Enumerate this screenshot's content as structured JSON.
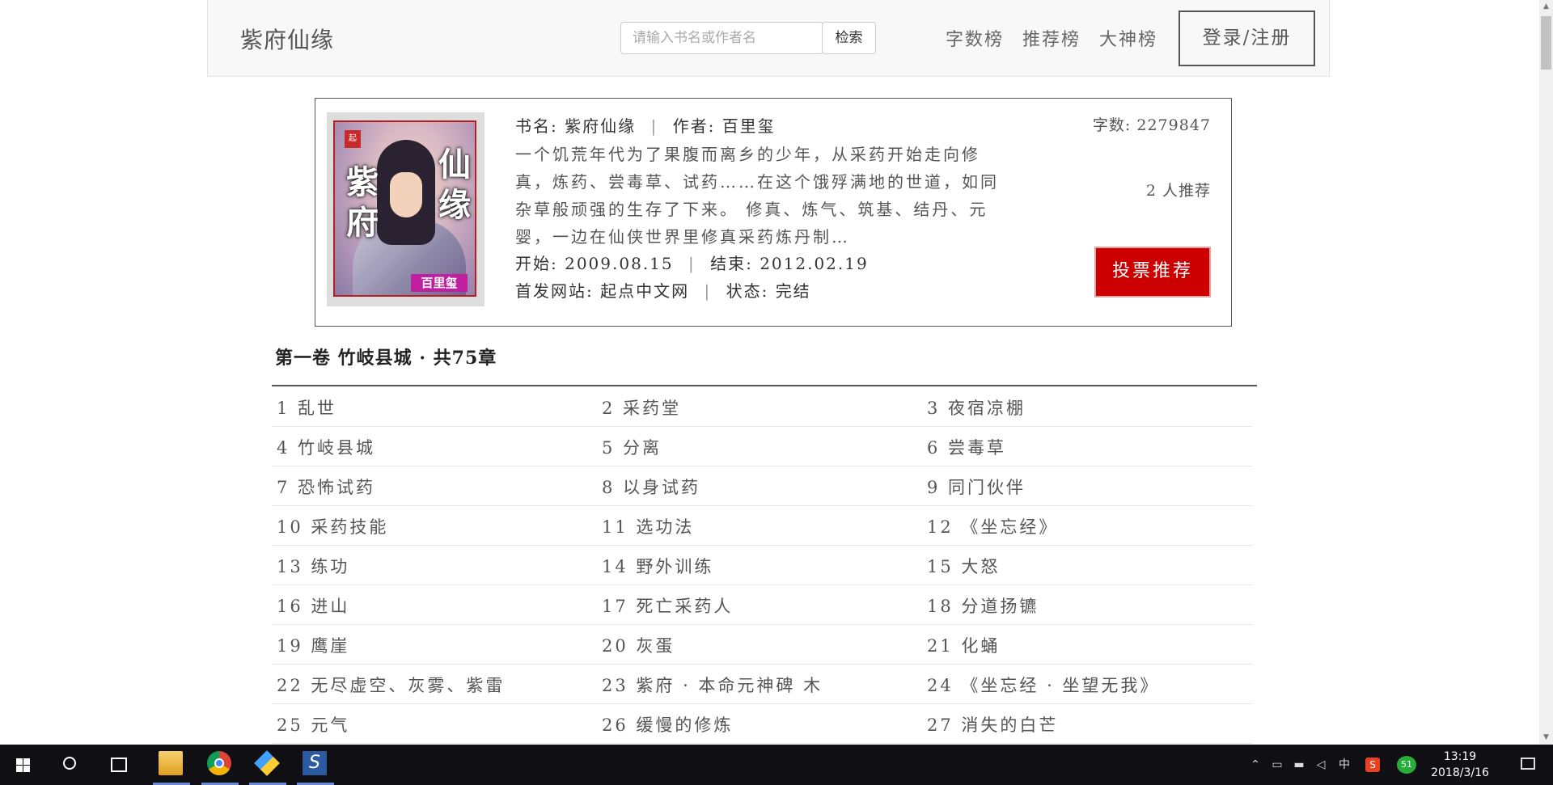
{
  "header": {
    "site_title": "紫府仙缘",
    "search_placeholder": "请输入书名或作者名",
    "search_button": "检索",
    "nav": [
      "字数榜",
      "推荐榜",
      "大神榜"
    ],
    "login_button": "登录/注册"
  },
  "book": {
    "cover": {
      "title_chars": [
        "紫",
        "府",
        "仙",
        "缘"
      ],
      "seal_text": "起",
      "author_tag": "百里玺"
    },
    "title_label": "书名:",
    "title": "紫府仙缘",
    "separator": "|",
    "author_label": "作者:",
    "author": "百里玺",
    "summary": "一个饥荒年代为了果腹而离乡的少年，从采药开始走向修真，炼药、尝毒草、试药……在这个饿殍满地的世道，如同杂草般顽强的生存了下来。 修真、炼气、筑基、结丹、元婴，一边在仙侠世界里修真采药炼丹制…",
    "start_label": "开始:",
    "start_date": "2009.08.15",
    "end_label": "结束:",
    "end_date": "2012.02.19",
    "site_label": "首发网站:",
    "site": "起点中文网",
    "status_label": "状态:",
    "status": "完结",
    "word_count_label": "字数:",
    "word_count": "2279847",
    "recommend_count": "2 人推荐",
    "vote_button": "投票推荐"
  },
  "volume": {
    "title": "第一卷 竹岐县城 · 共75章"
  },
  "chapters": [
    [
      "1 乱世",
      "2 采药堂",
      "3 夜宿凉棚"
    ],
    [
      "4 竹岐县城",
      "5 分离",
      "6 尝毒草"
    ],
    [
      "7 恐怖试药",
      "8 以身试药",
      "9 同门伙伴"
    ],
    [
      "10 采药技能",
      "11 选功法",
      "12 《坐忘经》"
    ],
    [
      "13 练功",
      "14 野外训练",
      "15 大怒"
    ],
    [
      "16 进山",
      "17 死亡采药人",
      "18 分道扬镳"
    ],
    [
      "19 鹰崖",
      "20 灰蛋",
      "21 化蛹"
    ],
    [
      "22 无尽虚空、灰雾、紫雷",
      "23 紫府 · 本命元神碑 木",
      "24 《坐忘经 · 坐望无我》"
    ],
    [
      "25 元气",
      "26 缓慢的修炼",
      "27 消失的白芒"
    ]
  ],
  "taskbar": {
    "tray_ime": "中",
    "tray_badge": "51",
    "time": "13:19",
    "date": "2018/3/16",
    "colors": {
      "taskbar_bg": "#0f0f14",
      "vote_red": "#cc0000"
    }
  }
}
